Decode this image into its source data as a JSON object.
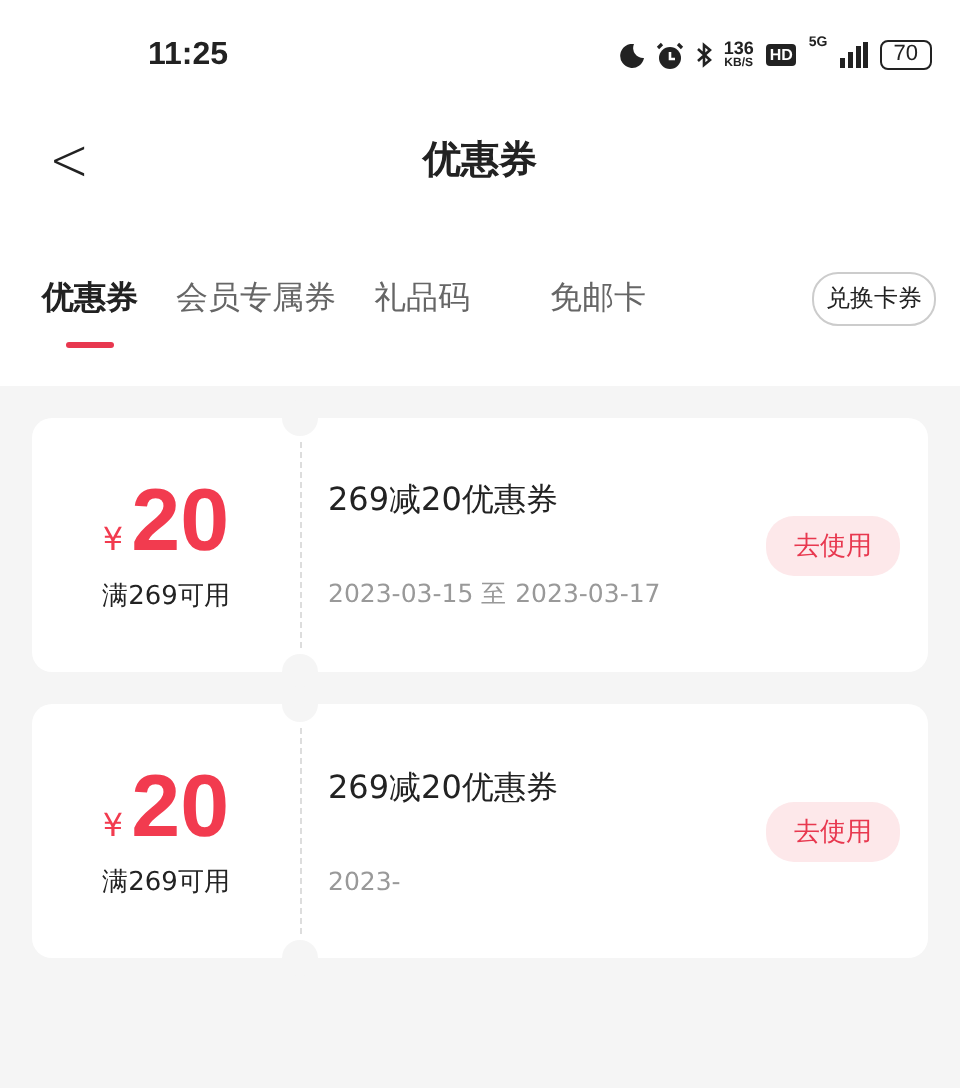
{
  "status_bar": {
    "time": "11:25",
    "speed_value": "136",
    "speed_unit": "KB/S",
    "hd": "HD",
    "network": "5G",
    "battery": "70"
  },
  "header": {
    "back": "<",
    "title": "优惠券"
  },
  "tabs": [
    {
      "label": "优惠券",
      "selected": true
    },
    {
      "label": "会员专属券",
      "selected": false
    },
    {
      "label": "礼品码",
      "selected": false
    },
    {
      "label": "免邮卡",
      "selected": false
    }
  ],
  "redeem_button": "兑换卡券",
  "coupons": [
    {
      "currency": "¥",
      "amount": "20",
      "condition": "满269可用",
      "title": "269减20优惠券",
      "validity": "2023-03-15 至 2023-03-17",
      "action": "去使用"
    },
    {
      "currency": "¥",
      "amount": "20",
      "condition": "满269可用",
      "title": "269减20优惠券",
      "validity": "2023-",
      "action": "去使用"
    }
  ]
}
